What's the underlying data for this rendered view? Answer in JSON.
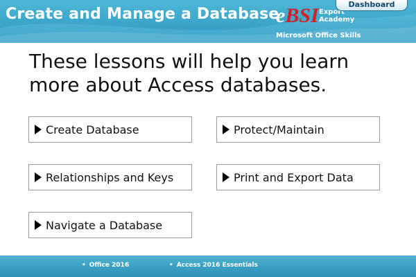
{
  "header": {
    "title": "Create and Manage a Database",
    "dashboard_label": "Dashboard",
    "logo": {
      "mark_e": "e",
      "mark_rest": "BSI",
      "line1": "Export",
      "line2": "Academy",
      "subtitle": "Microsoft Office Skills"
    }
  },
  "main": {
    "intro_text": "These lessons will help you learn more about Access databases.",
    "lessons": [
      {
        "label": "Create Database",
        "icon": "play-triangle-icon"
      },
      {
        "label": "Protect/Maintain",
        "icon": "play-triangle-icon"
      },
      {
        "label": "Relationships and Keys",
        "icon": "play-triangle-icon"
      },
      {
        "label": "Print and Export Data",
        "icon": "play-triangle-icon"
      },
      {
        "label": "Navigate a Database",
        "icon": "play-triangle-icon"
      }
    ]
  },
  "footer": {
    "items": [
      "Office 2016",
      "Access 2016 Essentials"
    ],
    "bullet": "•"
  },
  "colors": {
    "header_blue": "#2a95c0",
    "footer_blue": "#2b8fb8",
    "logo_red": "#d0202a",
    "button_border": "#9a9a9a"
  }
}
